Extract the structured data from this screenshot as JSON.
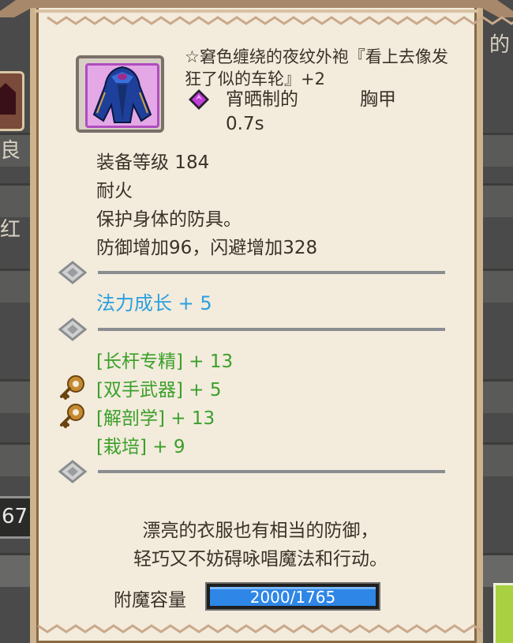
{
  "item": {
    "name": "☆窘色缠绕的夜纹外袍『看上去像发狂了似的车轮』+2",
    "subtype": "宵晒制的",
    "slot": "胸甲",
    "time": "0.7s",
    "icon": "robe-icon",
    "gem_icon": "purple-gem-icon"
  },
  "stats": {
    "level": "装备等级 184",
    "resist": "耐火",
    "description_short": "保护身体的防具。",
    "defense": "防御增加96，闪避增加328"
  },
  "mana_bonus": "法力成长 + 5",
  "skills": [
    {
      "label": "[长杆专精] + 13",
      "icon": ""
    },
    {
      "label": "[双手武器] + 5",
      "icon": "key-icon"
    },
    {
      "label": "[解剖学] + 13",
      "icon": "key-icon"
    },
    {
      "label": "[栽培] + 9",
      "icon": ""
    }
  ],
  "flavor": {
    "line1": "漂亮的衣服也有相当的防御，",
    "line2": "轻巧又不妨碍咏唱魔法和行动。"
  },
  "enchant": {
    "label": "附魔容量",
    "value_text": "2000/1765",
    "fill_fraction": 1.0
  },
  "background": {
    "left_box_text": "67",
    "side_chars": [
      "良",
      "红",
      "的"
    ]
  },
  "colors": {
    "panel": "#f3ebdc",
    "mana": "#2aa0e0",
    "skill": "#3aa02a",
    "bar": "#2e86e6"
  }
}
